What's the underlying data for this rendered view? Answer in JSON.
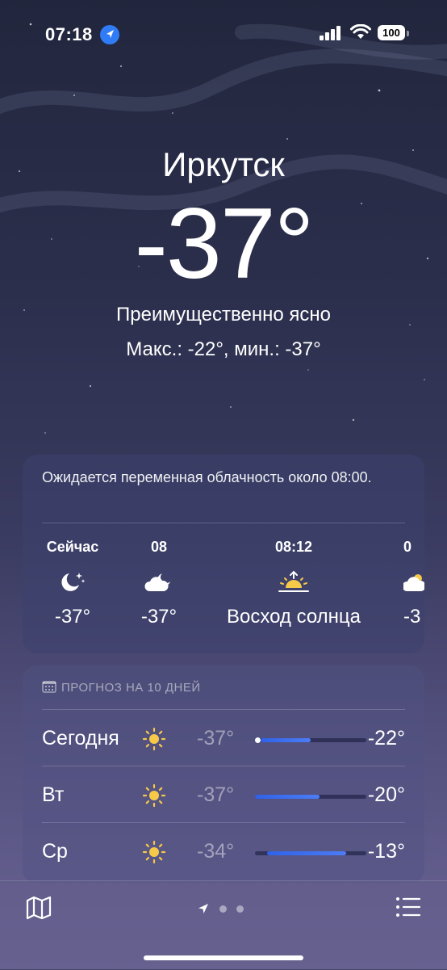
{
  "status_bar": {
    "time": "07:18",
    "battery": "100"
  },
  "location": {
    "city": "Иркутск",
    "temperature": "-37°",
    "condition": "Преимущественно ясно",
    "hi_lo": "Макс.: -22°, мин.: -37°"
  },
  "hourly": {
    "summary": "Ожидается переменная облачность около 08:00.",
    "items": [
      {
        "label": "Сейчас",
        "icon": "moon-stars-icon",
        "value": "-37°"
      },
      {
        "label": "08",
        "icon": "cloud-moon-icon",
        "value": "-37°"
      },
      {
        "label": "08:12",
        "icon": "sunrise-icon",
        "value": "Восход солнца"
      },
      {
        "label": "0",
        "icon": "cloud-sun-icon",
        "value": "-3"
      }
    ]
  },
  "forecast": {
    "header": "ПРОГНОЗ НА 10 ДНЕЙ",
    "days": [
      {
        "day": "Сегодня",
        "icon": "sun-icon",
        "low": "-37°",
        "high": "-22°",
        "range_start": 0.05,
        "range_end": 0.5,
        "current": 0.02
      },
      {
        "day": "Вт",
        "icon": "sun-icon",
        "low": "-37°",
        "high": "-20°",
        "range_start": 0.0,
        "range_end": 0.58
      },
      {
        "day": "Ср",
        "icon": "sun-icon",
        "low": "-34°",
        "high": "-13°",
        "range_start": 0.11,
        "range_end": 0.82
      }
    ]
  },
  "bottom_bar": {
    "pages": 3,
    "active_page": 0
  }
}
